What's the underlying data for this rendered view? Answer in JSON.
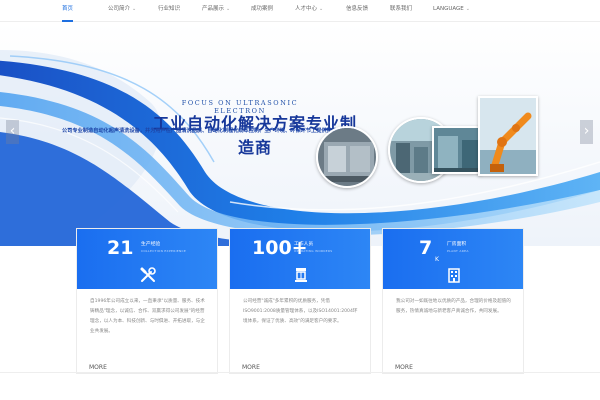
{
  "nav": {
    "items": [
      {
        "label": "首页",
        "active": true,
        "dropdown": false
      },
      {
        "label": "公司简介",
        "active": false,
        "dropdown": true
      },
      {
        "label": "行业知识",
        "active": false,
        "dropdown": false
      },
      {
        "label": "产品展示",
        "active": false,
        "dropdown": true
      },
      {
        "label": "成功案例",
        "active": false,
        "dropdown": false
      },
      {
        "label": "人才中心",
        "active": false,
        "dropdown": true
      },
      {
        "label": "信息反馈",
        "active": false,
        "dropdown": false
      },
      {
        "label": "联系我们",
        "active": false,
        "dropdown": false
      },
      {
        "label": "LANGUAGE",
        "active": false,
        "dropdown": true
      }
    ]
  },
  "banner": {
    "focus": "FOCUS ON ULTRASONIC ELECTRON",
    "title": "工业自动化解决方案专业制造商",
    "subtitle": "公司专业制造自动化超声清洗设备，并为用户在产品清洗品质、自动化制程化成本控制、生产环境、环保环节上提供整体解决方案",
    "prev_icon": "‹",
    "next_icon": "›"
  },
  "cards": [
    {
      "number": "21",
      "label": "生产经验",
      "label_en": "COLLECTION EXPERIENCE",
      "unit": "",
      "icon": "tools-icon",
      "text": "自1996年公司成立以来，一直秉承\"以质量、服务、技术铸精品\"理念，以诚信、合作、双赢求得公司发展\"的经营理念，以人为本、科技创新、与时俱进、开拓进取，与企业共发展。",
      "more": "MORE"
    },
    {
      "number": "100+",
      "label": "工作人员",
      "label_en": "OPERATING WORKERS",
      "unit": "",
      "icon": "machine-icon",
      "text": "公司经营\"诚成\"多年累积的优质服务，凭借ISO9001:2008质量管理体系，以及ISO14001:2004环境体系，保证了优质、高效\"的满足客户的要求。",
      "more": "MORE"
    },
    {
      "number": "7",
      "label": "厂房面积",
      "label_en": "PLANT AREA",
      "unit": "K",
      "icon": "building-icon",
      "text": "我公司对一如既往地以优质的产品，合理的价格及超值的服务，热情真诚地与新老客户真诚合作，共同发展。",
      "more": "MORE"
    }
  ],
  "colors": {
    "accent": "#1e6fe0",
    "card_head": "#1a6ef0",
    "title": "#16379a"
  }
}
